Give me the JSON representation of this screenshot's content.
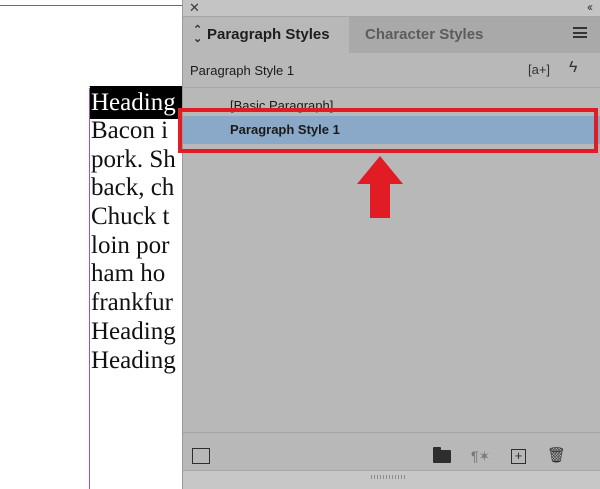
{
  "document": {
    "lines": [
      "Heading",
      "Bacon i",
      "pork. Sh",
      "back, ch",
      "Chuck t",
      "loin por",
      "ham ho",
      "frankfur",
      "Heading",
      "Heading"
    ],
    "right_fragments": [
      "i",
      "-",
      "-",
      "ɪ",
      "r"
    ]
  },
  "panel": {
    "tabs": {
      "active": "Paragraph Styles",
      "inactive": "Character Styles"
    },
    "current_style": "Paragraph Style 1",
    "styles": [
      {
        "label": "[Basic Paragraph]",
        "selected": false
      },
      {
        "label": "Paragraph Style 1",
        "selected": true
      }
    ],
    "icons": {
      "close": "close-icon",
      "collapse": "collapse-icon",
      "menu": "panel-menu-icon",
      "new_from_selection": "new-style-from-selection-icon",
      "lightning": "quick-apply-icon",
      "load": "load-styles-icon",
      "folder": "new-style-group-icon",
      "clear_overrides": "clear-overrides-icon",
      "new_style": "create-new-style-icon",
      "delete": "trash-icon"
    }
  },
  "annotation": {
    "highlight_color": "#e21c25",
    "selected_row_color": "#8aa8c7"
  }
}
